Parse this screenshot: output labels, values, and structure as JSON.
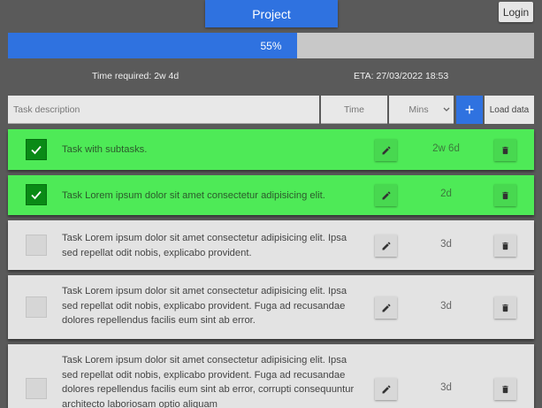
{
  "header": {
    "project_label": "Project",
    "login_label": "Login"
  },
  "progress": {
    "value_percent": 55,
    "label": "55%"
  },
  "summary": {
    "time_required": "Time required: 2w 4d",
    "eta": "ETA: 27/03/2022 18:53"
  },
  "form": {
    "task_placeholder": "Task description",
    "time_placeholder": "Time",
    "unit_selected": "Mins",
    "add_label": "+",
    "load_label": "Load data"
  },
  "tasks": [
    {
      "text": "Task with subtasks.",
      "duration": "2w 6d",
      "done": true
    },
    {
      "text": "Task Lorem ipsum dolor sit amet consectetur adipisicing elit.",
      "duration": "2d",
      "done": true
    },
    {
      "text": "Task Lorem ipsum dolor sit amet consectetur adipisicing elit. Ipsa sed repellat odit nobis, explicabo provident.",
      "duration": "3d",
      "done": false
    },
    {
      "text": "Task Lorem ipsum dolor sit amet consectetur adipisicing elit. Ipsa sed repellat odit nobis, explicabo provident. Fuga ad recusandae dolores repellendus facilis eum sint ab error.",
      "duration": "3d",
      "done": false
    },
    {
      "text": "Task Lorem ipsum dolor sit amet consectetur adipisicing elit. Ipsa sed repellat odit nobis, explicabo provident. Fuga ad recusandae dolores repellendus facilis eum sint ab error, corrupti consequuntur architecto laboriosam optio aliquam",
      "duration": "3d",
      "done": false
    }
  ],
  "icons": {
    "checkmark": "check-icon",
    "edit": "pencil-icon",
    "delete": "trash-icon",
    "add": "plus-icon",
    "dropdown": "chevron-down-icon"
  },
  "colors": {
    "accent": "#2f72e0",
    "done_bg": "#4eea57",
    "done_check": "#0a8a16",
    "open_bg": "#e3e3e3",
    "page_bg": "#5a5a5a"
  }
}
